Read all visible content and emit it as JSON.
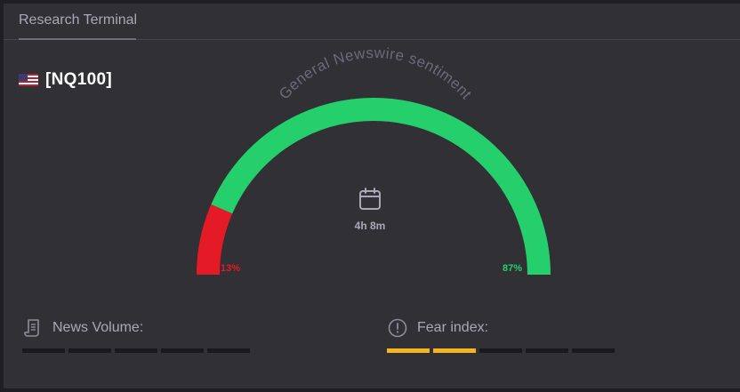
{
  "tabs": [
    {
      "label": "Research Terminal",
      "active": true
    }
  ],
  "instrument": {
    "ticker": "[NQ100]",
    "flag_icon": "us-flag-icon"
  },
  "sentiment": {
    "title": "General Newswire sentiment",
    "negative_pct": 13,
    "positive_pct": 87,
    "negative_label": "13%",
    "positive_label": "87%",
    "center_icon": "calendar-icon",
    "time_label": "4h 8m",
    "colors": {
      "negative": "#e51a27",
      "positive": "#25cf6c"
    }
  },
  "metrics": {
    "news_volume": {
      "label": "News Volume:",
      "icon": "document-icon",
      "level": 0,
      "segments": 5
    },
    "fear_index": {
      "label": "Fear index:",
      "icon": "alert-circle-icon",
      "level": 2,
      "segments": 5,
      "color": "#f4b520"
    }
  }
}
